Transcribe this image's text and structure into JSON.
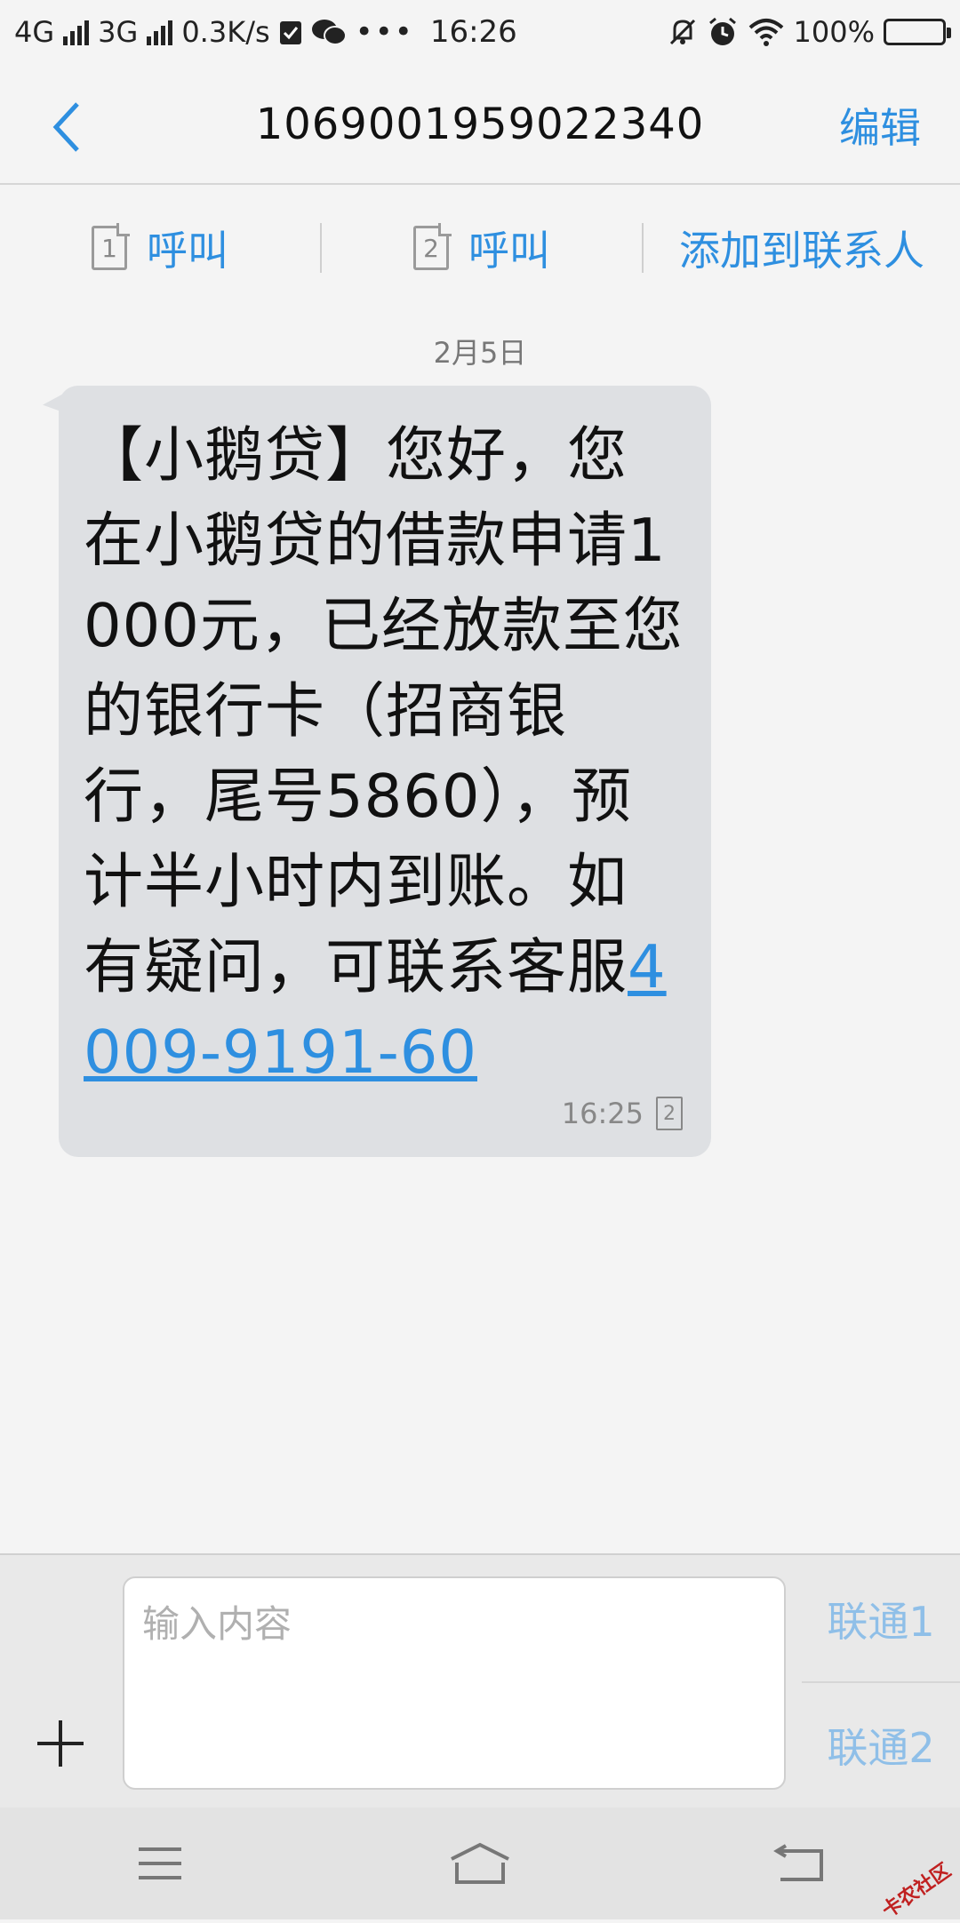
{
  "status_bar": {
    "network1": "4G",
    "network2": "3G",
    "speed": "0.3K/s",
    "time": "16:26",
    "battery": "100%"
  },
  "header": {
    "title": "1069001959022340",
    "edit_label": "编辑"
  },
  "actions": {
    "call_sim1_label": "呼叫",
    "sim1_number": "1",
    "call_sim2_label": "呼叫",
    "sim2_number": "2",
    "add_contact_label": "添加到联系人"
  },
  "conversation": {
    "date": "2月5日",
    "message": {
      "text": "【小鹅贷】您好，您在小鹅贷的借款申请1000元，已经放款至您的银行卡（招商银行，尾号5860），预计半小时内到账。如有疑问，可联系客服",
      "link": "4009-9191-60",
      "time": "16:25",
      "sim": "2"
    }
  },
  "composer": {
    "placeholder": "输入内容",
    "send_sim1": "联通1",
    "send_sim2": "联通2"
  },
  "watermark": "卡农社区",
  "colors": {
    "accent": "#2e8fe0",
    "bubble": "#dee0e3",
    "background": "#f4f4f4"
  }
}
